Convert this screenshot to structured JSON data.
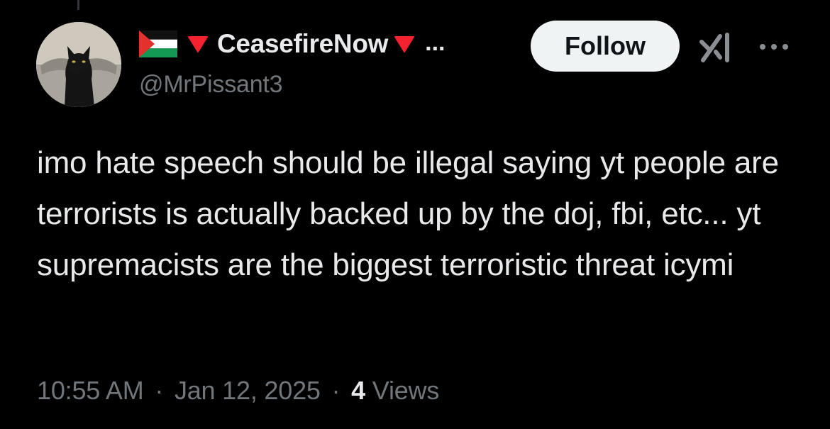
{
  "author": {
    "display_name": "CeasefireNow",
    "name_truncation": "...",
    "handle": "@MrPissant3",
    "icons": [
      "palestine-flag-icon",
      "red-triangle-icon",
      "red-triangle-icon"
    ]
  },
  "actions": {
    "follow_label": "Follow"
  },
  "tweet": {
    "text": "imo hate speech should be illegal saying yt people are terrorists is actually backed up by the doj, fbi, etc... yt supremacists are the biggest terroristic threat icymi"
  },
  "meta": {
    "time": "10:55 AM",
    "separator": "·",
    "date": "Jan 12, 2025",
    "views_count": "4",
    "views_label": "Views"
  },
  "colors": {
    "background": "#000000",
    "primary_text": "#e7e9ea",
    "secondary_text": "#71767b",
    "follow_bg": "#eff3f4",
    "triangle_red": "#f4212e"
  }
}
